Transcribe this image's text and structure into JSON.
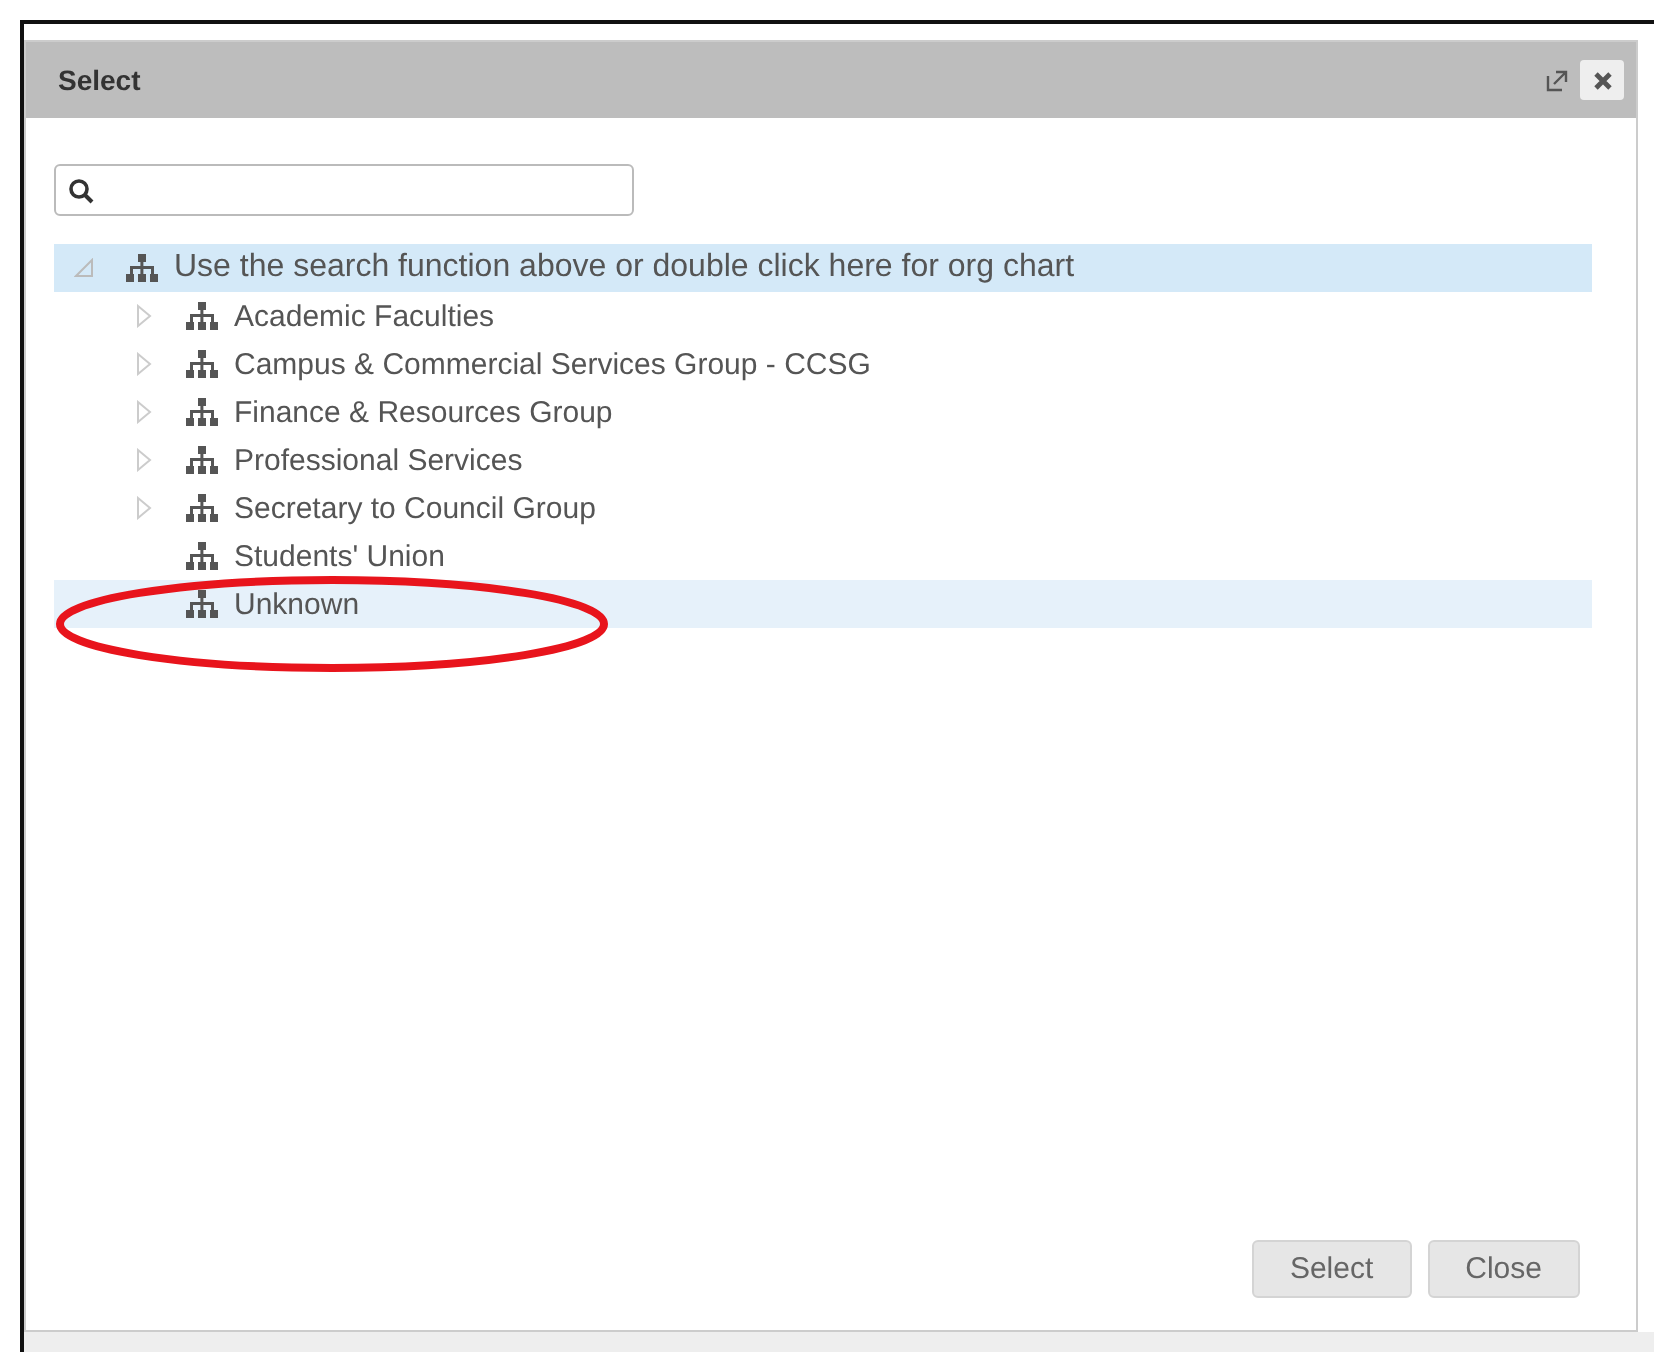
{
  "dialog": {
    "title": "Select",
    "tree": {
      "label": "Use the search function above or double click here for org chart",
      "expanded": true,
      "selected": true,
      "children": [
        {
          "label": "Academic Faculties",
          "expandable": true,
          "selected": false,
          "hovered": false
        },
        {
          "label": "Campus & Commercial Services Group - CCSG",
          "expandable": true,
          "selected": false,
          "hovered": false
        },
        {
          "label": "Finance & Resources Group",
          "expandable": true,
          "selected": false,
          "hovered": false
        },
        {
          "label": "Professional Services",
          "expandable": true,
          "selected": false,
          "hovered": false
        },
        {
          "label": "Secretary to Council Group",
          "expandable": true,
          "selected": false,
          "hovered": false
        },
        {
          "label": "Students' Union",
          "expandable": false,
          "selected": false,
          "hovered": false
        },
        {
          "label": "Unknown",
          "expandable": false,
          "selected": false,
          "hovered": true
        }
      ]
    },
    "buttons": [
      {
        "label": "Select"
      },
      {
        "label": "Close"
      }
    ]
  },
  "annotation": {
    "kind": "ellipse"
  }
}
